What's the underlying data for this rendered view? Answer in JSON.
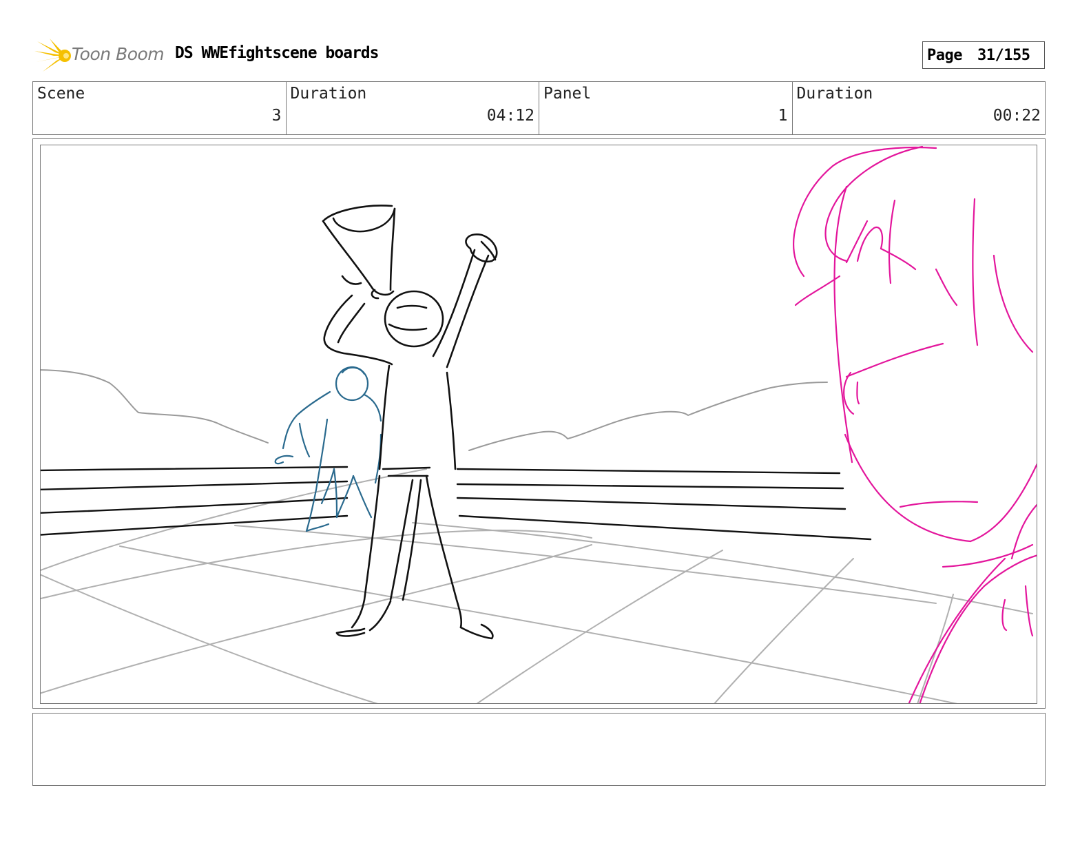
{
  "header": {
    "brand": "Toon Boom",
    "title": "DS WWEfightscene boards",
    "page_label": "Page",
    "page_value": "31/155"
  },
  "info": {
    "scene_label": "Scene",
    "scene_value": "3",
    "scene_duration_label": "Duration",
    "scene_duration_value": "04:12",
    "panel_label": "Panel",
    "panel_value": "1",
    "panel_duration_label": "Duration",
    "panel_duration_value": "00:22"
  },
  "colors": {
    "logo_yellow": "#f5c000",
    "sketch_black": "#111111",
    "sketch_gray": "#a8a8a8",
    "sketch_blue": "#2a6a8e",
    "sketch_magenta": "#e3169c"
  },
  "notes": {
    "text": ""
  }
}
